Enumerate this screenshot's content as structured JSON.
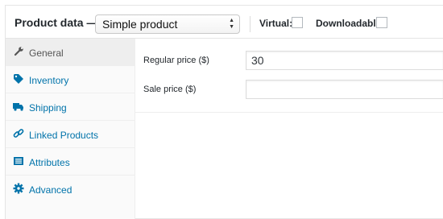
{
  "header": {
    "title": "Product data —",
    "product_type": {
      "selected": "Simple product"
    },
    "virtual_label": "Virtual:",
    "virtual_checked": false,
    "downloadable_label": "Downloadable:",
    "downloadable_checked": false
  },
  "tabs": [
    {
      "label": "General",
      "icon": "wrench-icon",
      "active": true
    },
    {
      "label": "Inventory",
      "icon": "tag-icon",
      "active": false
    },
    {
      "label": "Shipping",
      "icon": "truck-icon",
      "active": false
    },
    {
      "label": "Linked Products",
      "icon": "link-icon",
      "active": false
    },
    {
      "label": "Attributes",
      "icon": "list-icon",
      "active": false
    },
    {
      "label": "Advanced",
      "icon": "gear-icon",
      "active": false
    }
  ],
  "general": {
    "regular_price_label": "Regular price ($)",
    "regular_price_value": "30",
    "sale_price_label": "Sale price ($)",
    "sale_price_value": ""
  },
  "colors": {
    "link": "#0073aa",
    "active_tab_bg": "#eeeeee",
    "sidebar_bg": "#fafafa",
    "border": "#e5e5e5"
  }
}
